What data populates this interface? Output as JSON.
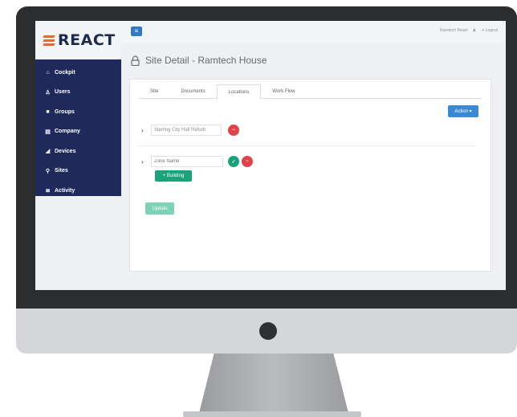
{
  "brand": {
    "name": "REACT",
    "accent": "#e66a2c",
    "nav_bg": "#1f2a5c"
  },
  "topbar": {
    "menu_icon": "menu-icon",
    "user_name": "Ramtech React",
    "user_icon": "user-icon",
    "logout_label": "Logout"
  },
  "sidebar": {
    "items": [
      {
        "label": "Cockpit",
        "icon": "home-icon"
      },
      {
        "label": "Users",
        "icon": "user-icon"
      },
      {
        "label": "Groups",
        "icon": "groups-icon"
      },
      {
        "label": "Company",
        "icon": "company-icon"
      },
      {
        "label": "Devices",
        "icon": "devices-icon"
      },
      {
        "label": "Sites",
        "icon": "location-icon"
      },
      {
        "label": "Activity",
        "icon": "activity-icon"
      }
    ]
  },
  "page": {
    "title": "Site Detail - Ramtech House"
  },
  "tabs": [
    {
      "label": "Site"
    },
    {
      "label": "Documents"
    },
    {
      "label": "Locations",
      "active": true
    },
    {
      "label": "Work Flow"
    }
  ],
  "actions": {
    "action_label": "Action ▾"
  },
  "locations": {
    "existing_name": "Sterling City Hall Refurb",
    "zone_placeholder": "Zone Name",
    "add_building_label": "+ Building",
    "update_label": "Update"
  }
}
